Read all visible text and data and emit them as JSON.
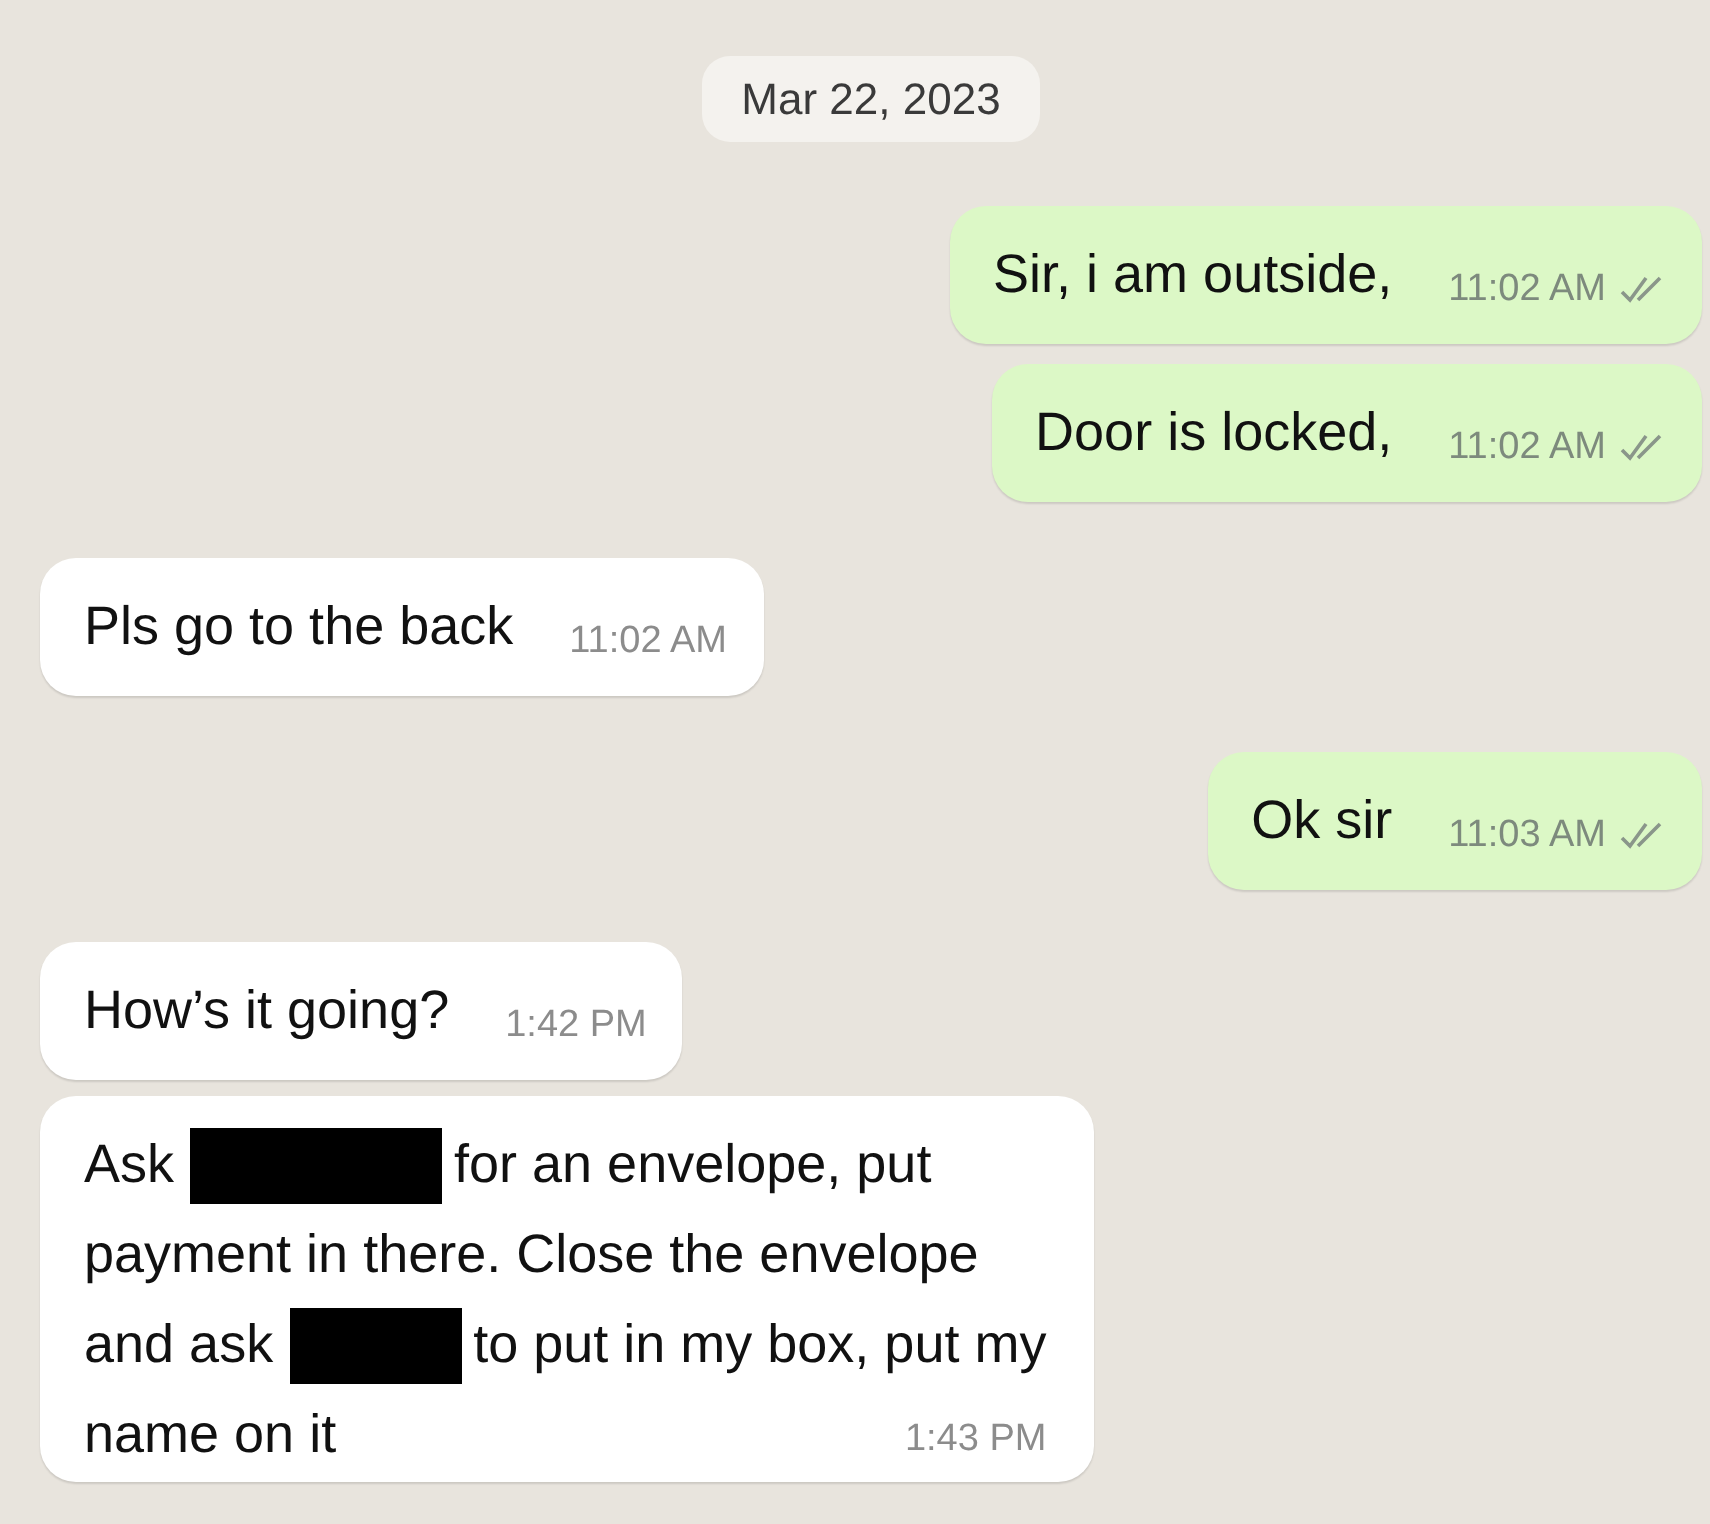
{
  "date_chip": "Mar 22, 2023",
  "messages": [
    {
      "outgoing": true,
      "lines": [
        [
          {
            "kind": "text",
            "text": "Sir, i am outside,"
          }
        ]
      ],
      "time": "11:02 AM",
      "delivered": true
    },
    {
      "outgoing": true,
      "lines": [
        [
          {
            "kind": "text",
            "text": "Door is locked,"
          }
        ]
      ],
      "time": "11:02 AM",
      "delivered": true
    },
    {
      "outgoing": false,
      "lines": [
        [
          {
            "kind": "text",
            "text": "Pls go to the back"
          }
        ]
      ],
      "time": "11:02 AM",
      "delivered": false
    },
    {
      "outgoing": true,
      "lines": [
        [
          {
            "kind": "text",
            "text": "Ok sir"
          }
        ]
      ],
      "time": "11:03 AM",
      "delivered": true
    },
    {
      "outgoing": false,
      "lines": [
        [
          {
            "kind": "text",
            "text": "How’s it going?"
          }
        ]
      ],
      "time": "1:42 PM",
      "delivered": false
    },
    {
      "outgoing": false,
      "lines": [
        [
          {
            "kind": "text",
            "text": "Ask"
          },
          {
            "kind": "redaction"
          },
          {
            "kind": "text",
            "text": "for an envelope, put"
          }
        ],
        [
          {
            "kind": "text",
            "text": "payment in there. Close the envelope"
          }
        ],
        [
          {
            "kind": "text",
            "text": "and ask"
          },
          {
            "kind": "redaction"
          },
          {
            "kind": "text",
            "text": "to put in my box, put my"
          }
        ],
        [
          {
            "kind": "text",
            "text": "name on it"
          }
        ]
      ],
      "time": "1:43 PM",
      "delivered": false
    }
  ]
}
